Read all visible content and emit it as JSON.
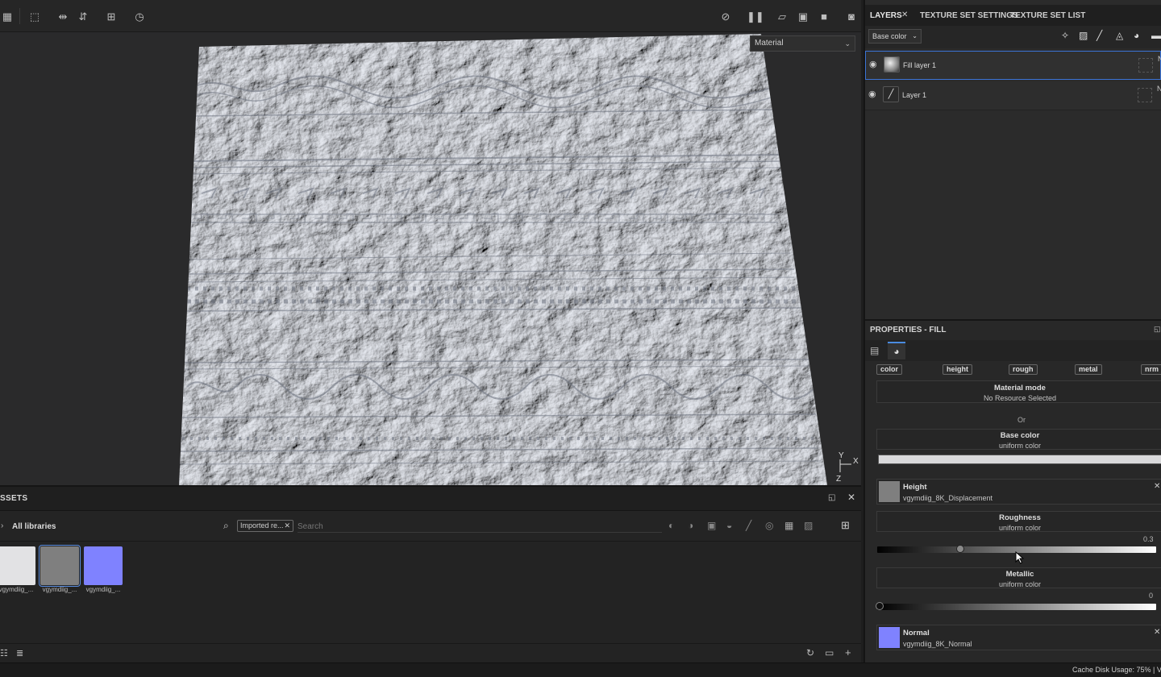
{
  "toolbar": {
    "icons": [
      "grid-select-icon",
      "box-select-icon",
      "mirror-x-icon",
      "mirror-y-icon",
      "add-frame-icon",
      "history-icon",
      "hide-ui-icon",
      "pause-icon",
      "camera-2d-icon",
      "camera-3d-icon",
      "video-icon",
      "screenshot-icon"
    ]
  },
  "viewport": {
    "mode": "Material",
    "axes": {
      "x": "X",
      "y": "Y",
      "z": "Z"
    }
  },
  "assets": {
    "title": "SSETS",
    "library": "All libraries",
    "filter_chip": "Imported re...",
    "search_placeholder": "Search",
    "items": [
      {
        "label": "vgymdiig_...",
        "color": "#e2e2e4"
      },
      {
        "label": "vgymdiig_...",
        "color": "#7f7f7f"
      },
      {
        "label": "vgymdiig_...",
        "color": "#7f82ff"
      }
    ]
  },
  "layers_panel": {
    "tabs": [
      {
        "label": "LAYERS"
      },
      {
        "label": "TEXTURE SET SETTINGS"
      },
      {
        "label": "TEXTURE SET LIST"
      }
    ],
    "channel": "Base color",
    "layers": [
      {
        "name": "Fill layer 1",
        "selected": true
      },
      {
        "name": "Layer 1",
        "selected": false
      }
    ],
    "layer_right_letter": "N"
  },
  "properties": {
    "title": "PROPERTIES - FILL",
    "channel_buttons": [
      "color",
      "height",
      "rough",
      "metal",
      "nrm"
    ],
    "material_mode": {
      "title": "Material mode",
      "value": "No Resource Selected"
    },
    "or_label": "Or",
    "base_color": {
      "title": "Base color",
      "value": "uniform color",
      "color": "#d9d9db"
    },
    "height": {
      "title": "Height",
      "value": "vgymdiig_8K_Displacement",
      "color": "#7f7f7f"
    },
    "roughness": {
      "title": "Roughness",
      "value": "uniform color",
      "level": "0.3"
    },
    "metallic": {
      "title": "Metallic",
      "value": "uniform color",
      "level": "0"
    },
    "normal": {
      "title": "Normal",
      "value": "vgymdiig_8K_Normal",
      "color": "#7f82ff"
    }
  },
  "status": {
    "text": "Cache Disk Usage:  75% | V"
  }
}
